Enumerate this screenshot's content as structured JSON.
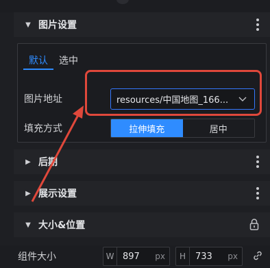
{
  "sections": {
    "image_settings": {
      "title": "图片设置"
    },
    "post_processing": {
      "title": "后期"
    },
    "display_settings": {
      "title": "展示设置"
    },
    "size_position": {
      "title": "大小&位置"
    }
  },
  "tabs": [
    {
      "label": "默认",
      "active": true
    },
    {
      "label": "选中",
      "active": false
    }
  ],
  "image_address": {
    "label": "图片地址",
    "value": "resources/中国地图_166..."
  },
  "fill_mode": {
    "label": "填充方式",
    "options": [
      "拉伸填充",
      "居中"
    ],
    "selected": "拉伸填充"
  },
  "component_size": {
    "label": "组件大小",
    "width_key": "W",
    "width": "897",
    "height_key": "H",
    "height": "733",
    "unit": "px"
  },
  "colors": {
    "accent": "#2f8cff",
    "highlight": "#e0483b",
    "panel": "#1e1f23"
  }
}
